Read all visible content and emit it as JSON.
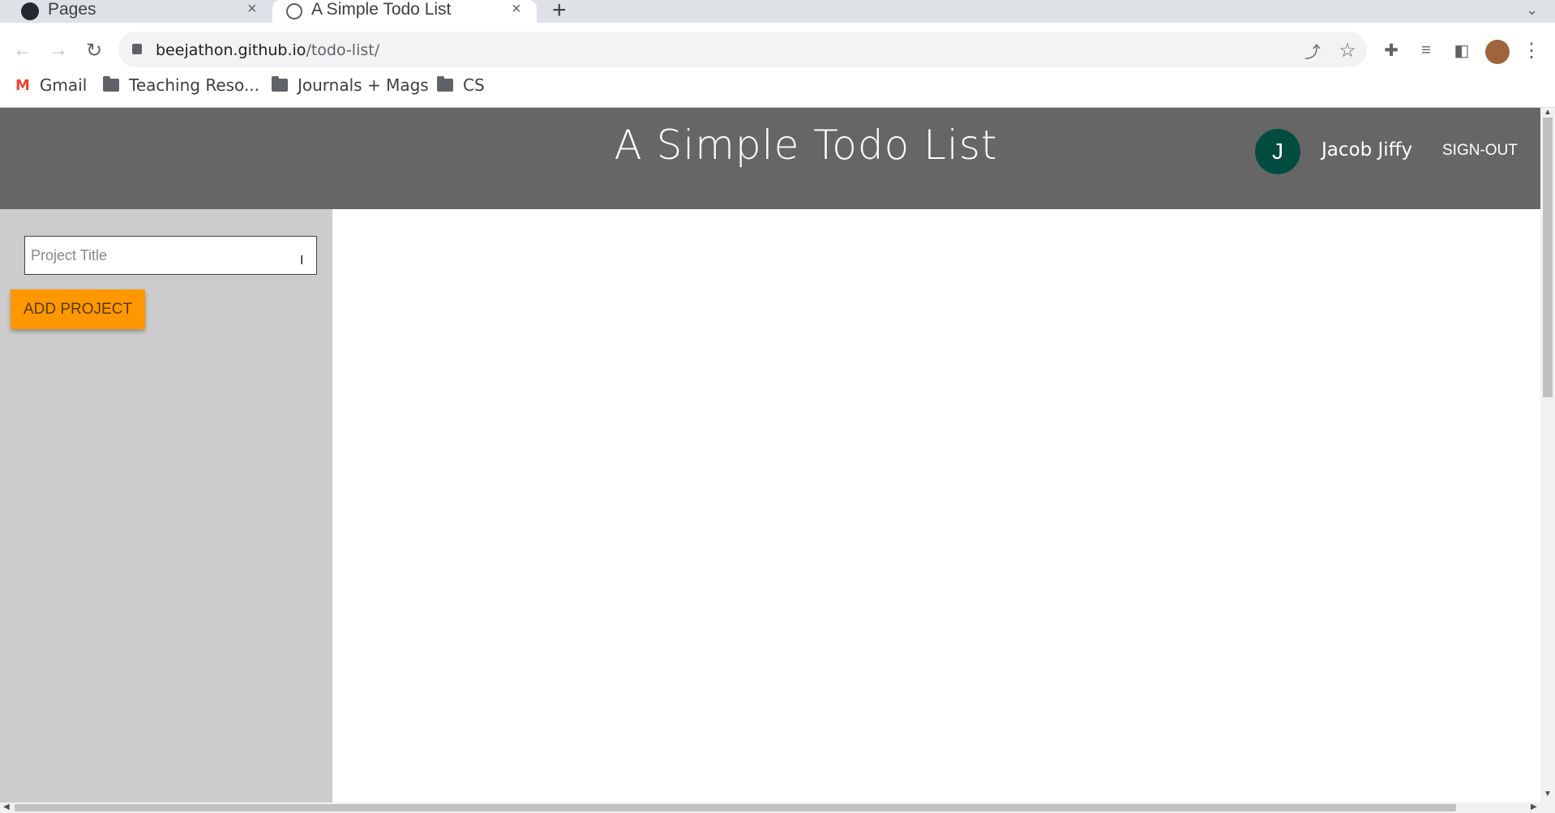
{
  "browser": {
    "tabs": [
      {
        "title": "Pages",
        "close": "×"
      },
      {
        "title": "A Simple Todo List",
        "close": "×"
      }
    ],
    "new_tab": "+",
    "url_host": "beejathon.github.io",
    "url_path": "/todo-list/",
    "bookmarks": [
      "Gmail",
      "Teaching Reso...",
      "Journals + Mags",
      "CS"
    ]
  },
  "app": {
    "title": "A Simple Todo List",
    "user": {
      "initial": "J",
      "name": "Jacob Jiffy"
    },
    "signout_label": "SIGN-OUT",
    "project_input_placeholder": "Project Title",
    "add_project_label": "ADD PROJECT"
  },
  "colors": {
    "header": "#666666",
    "sidebar": "#cccccc",
    "accent": "#ff9800",
    "avatar": "#004d40"
  }
}
